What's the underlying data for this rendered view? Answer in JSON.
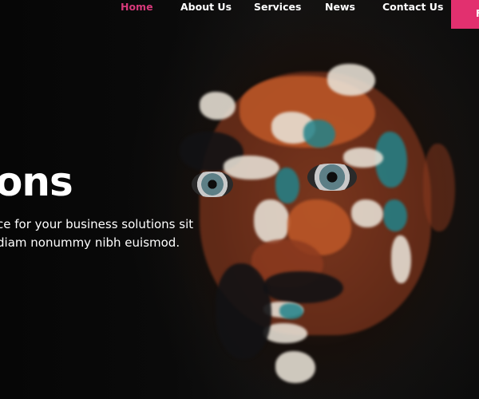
{
  "nav": {
    "items": [
      {
        "label": "Home",
        "active": true
      },
      {
        "label": "About Us",
        "active": false
      },
      {
        "label": "Services",
        "active": false
      },
      {
        "label": "News",
        "active": false
      },
      {
        "label": "Contact Us",
        "active": false
      }
    ],
    "cta_label": "F"
  },
  "hero": {
    "heading": "ons",
    "body_lines": [
      "ce for your business solutions sit",
      "diam nonummy nibh euismod."
    ]
  },
  "colors": {
    "accent": "#e2306f",
    "active_nav": "#d6397a",
    "text": "#ffffff",
    "background": "#090909"
  }
}
